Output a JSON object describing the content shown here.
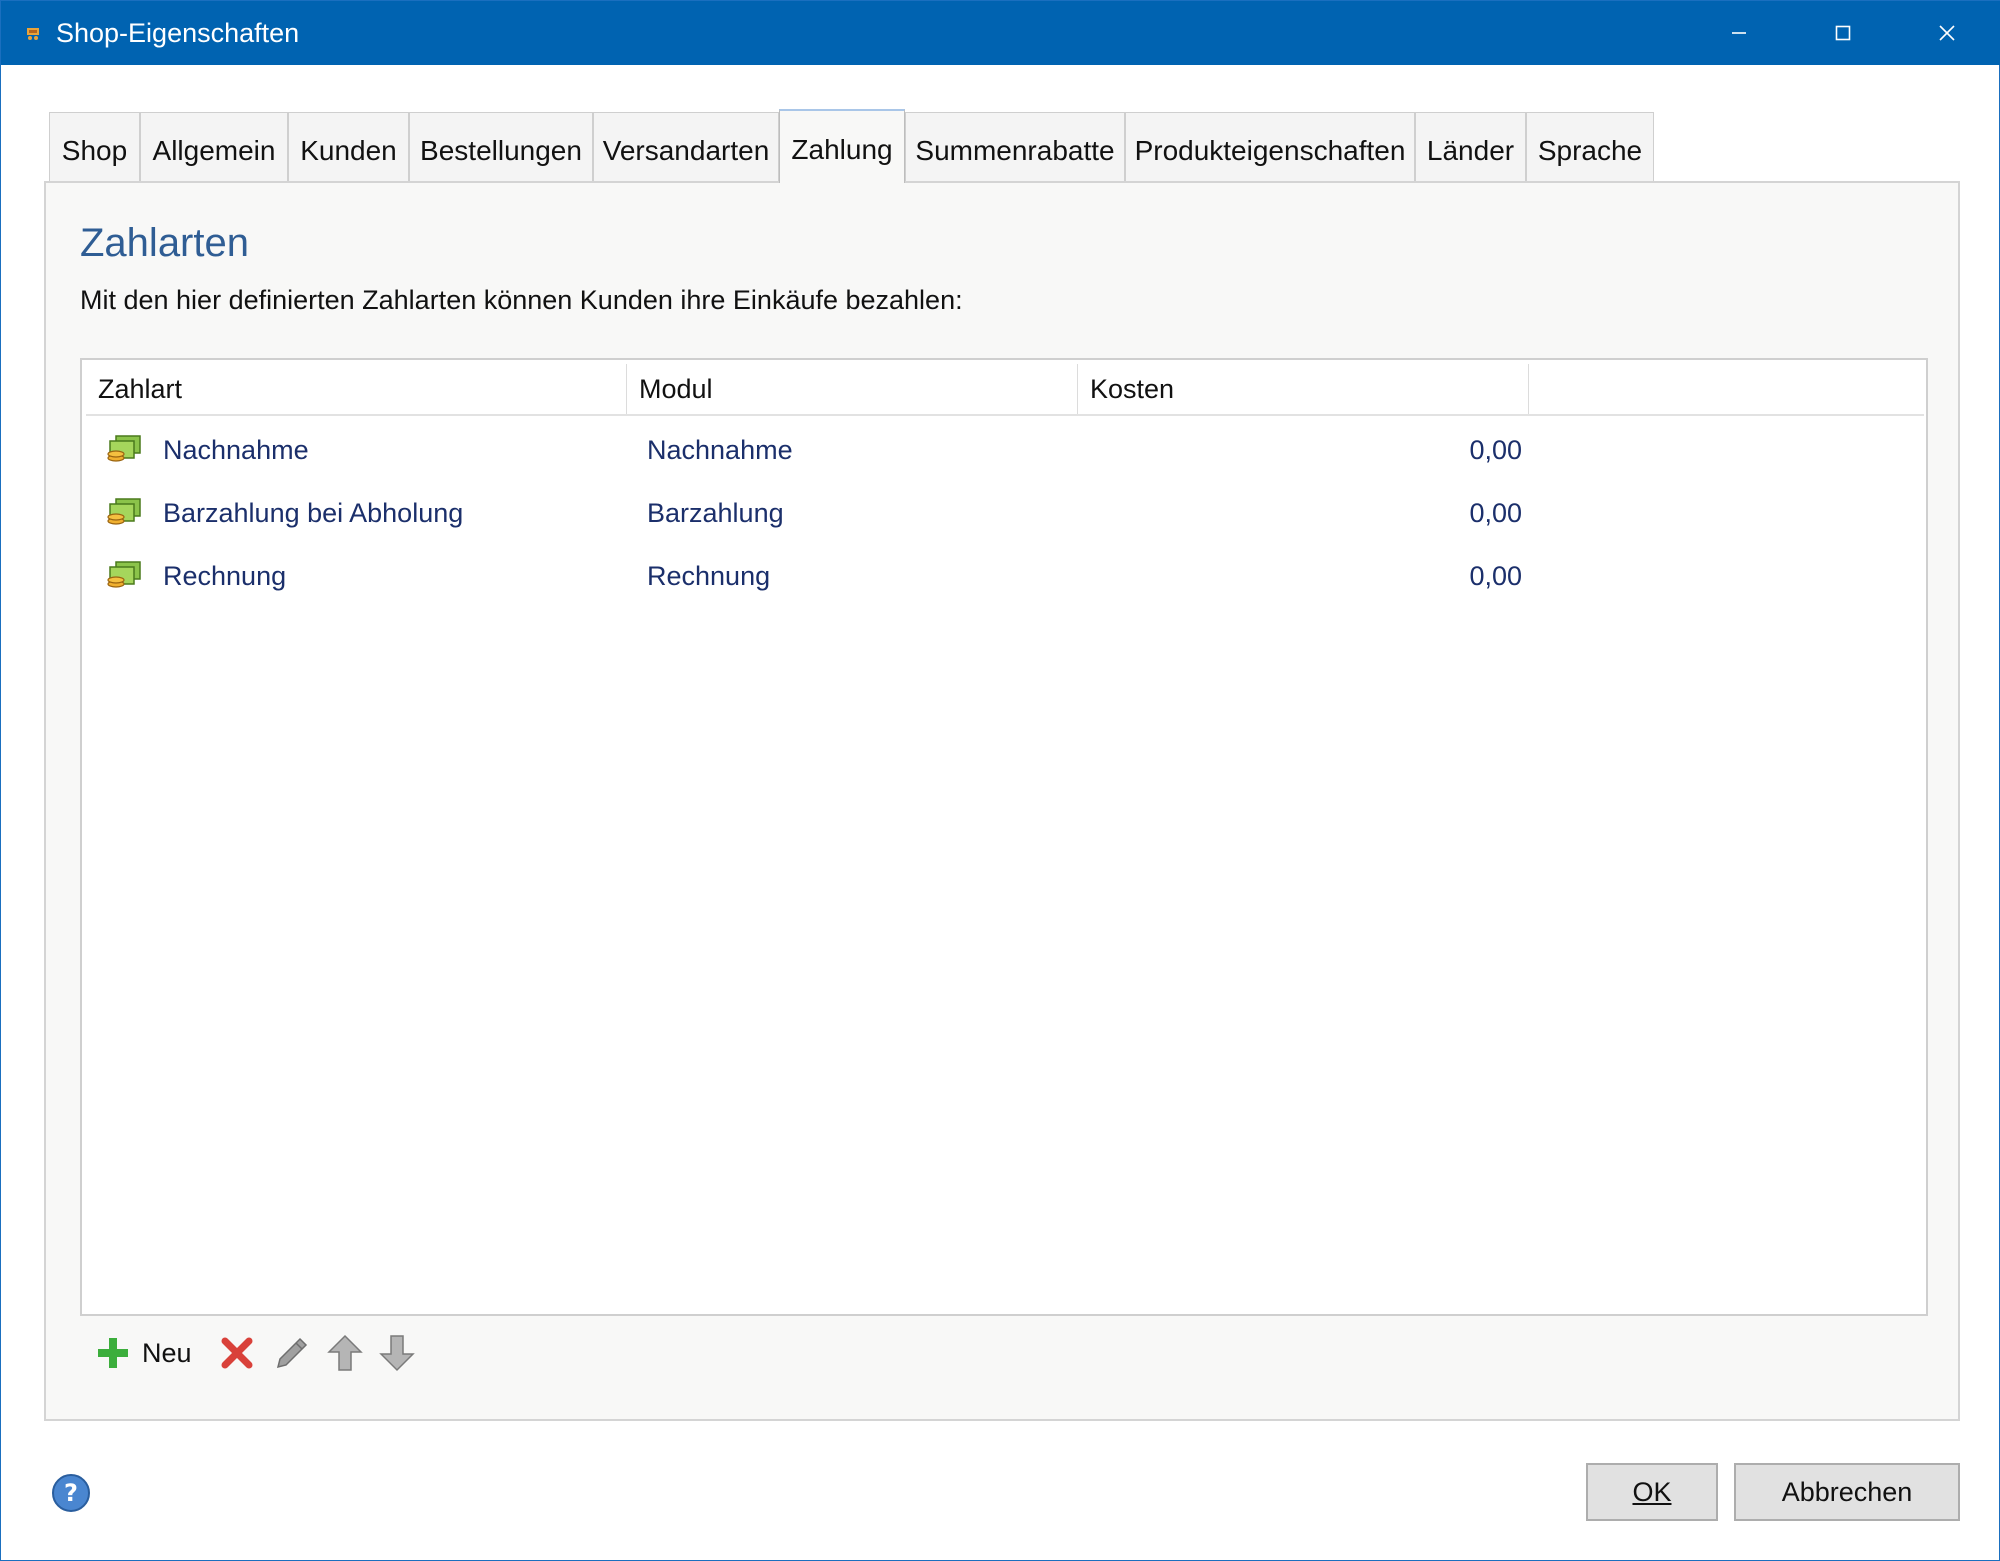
{
  "window": {
    "title": "Shop-Eigenschaften",
    "icon": "shop-cart-icon",
    "controls": {
      "minimize": "minimize-icon",
      "maximize": "maximize-icon",
      "close": "close-icon"
    }
  },
  "tabs": [
    {
      "label": "Shop",
      "active": false
    },
    {
      "label": "Allgemein",
      "active": false
    },
    {
      "label": "Kunden",
      "active": false
    },
    {
      "label": "Bestellungen",
      "active": false
    },
    {
      "label": "Versandarten",
      "active": false
    },
    {
      "label": "Zahlung",
      "active": true
    },
    {
      "label": "Summenrabatte",
      "active": false
    },
    {
      "label": "Produkteigenschaften",
      "active": false
    },
    {
      "label": "Länder",
      "active": false
    },
    {
      "label": "Sprache",
      "active": false
    }
  ],
  "panel": {
    "heading": "Zahlarten",
    "description": "Mit den hier definierten Zahlarten können Kunden ihre Einkäufe bezahlen:"
  },
  "table": {
    "columns": [
      "Zahlart",
      "Modul",
      "Kosten"
    ],
    "rows": [
      {
        "icon": "money-icon",
        "zahlart": "Nachnahme",
        "modul": "Nachnahme",
        "kosten": "0,00"
      },
      {
        "icon": "money-icon",
        "zahlart": "Barzahlung bei Abholung",
        "modul": "Barzahlung",
        "kosten": "0,00"
      },
      {
        "icon": "money-icon",
        "zahlart": "Rechnung",
        "modul": "Rechnung",
        "kosten": "0,00"
      }
    ]
  },
  "toolbar": {
    "new_label": "Neu",
    "icons": [
      "add-icon",
      "delete-icon",
      "edit-icon",
      "move-up-icon",
      "move-down-icon"
    ]
  },
  "footer": {
    "help_icon": "help-icon",
    "ok_label": "OK",
    "cancel_label": "Abbrechen"
  },
  "colors": {
    "titlebar": "#0063b1",
    "heading": "#2f5d94",
    "row_text": "#1b2f6b"
  }
}
